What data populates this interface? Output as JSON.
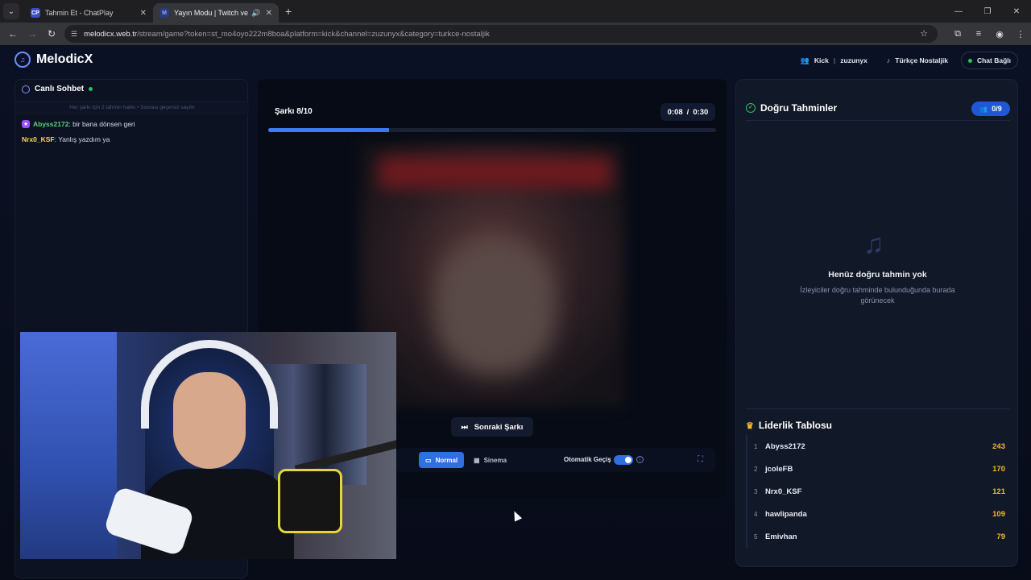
{
  "browser": {
    "tabs": [
      {
        "title": "Tahmin Et - ChatPlay",
        "favicon": "CP"
      },
      {
        "title": "Yayın Modu | Twitch ve Kick",
        "favicon": "M"
      }
    ],
    "url_host": "melodicx.web.tr",
    "url_path": "/stream/game?token=st_mo4oyo222m8boa&platform=kick&channel=zuzunyx&category=turkce-nostaljik"
  },
  "app": {
    "brand": "MelodicX",
    "header": {
      "platform": "Kick",
      "channel": "zuzunyx",
      "category": "Türkçe Nostaljik",
      "chat_status": "Chat Bağlı"
    },
    "chat": {
      "title": "Canlı Sohbet",
      "note": "Her şarkı için 2 tahmin hakkı • Sonrası geçersiz sayılır",
      "messages": [
        {
          "user": "Abyss2172",
          "text": ": bir bana dönsen geri"
        },
        {
          "user": "Nrx0_KSF",
          "text": ": Yanlış yazdım ya"
        }
      ]
    },
    "player": {
      "song_label": "Şarkı 8/10",
      "elapsed": "0:08",
      "time_sep": "/",
      "duration": "0:30",
      "progress": 0.27,
      "next_label": "Sonraki Şarkı",
      "mode_normal": "Normal",
      "mode_sinema": "Sinema",
      "auto_label": "Otomatik Geçiş",
      "auto_on": true
    },
    "correct": {
      "title": "Doğru Tahminler",
      "count": "0/9",
      "empty_title": "Henüz doğru tahmin yok",
      "empty_desc": "İzleyiciler doğru tahminde bulunduğunda burada görünecek"
    },
    "leaderboard": {
      "title": "Liderlik Tablosu",
      "rows": [
        {
          "rank": "1",
          "name": "Abyss2172",
          "score": "243"
        },
        {
          "rank": "2",
          "name": "jcoleFB",
          "score": "170"
        },
        {
          "rank": "3",
          "name": "Nrx0_KSF",
          "score": "121"
        },
        {
          "rank": "4",
          "name": "hawlipanda",
          "score": "109"
        },
        {
          "rank": "5",
          "name": "Emivhan",
          "score": "79"
        }
      ]
    }
  },
  "colors": {
    "accent": "#3b7df5",
    "live": "#22c55e",
    "gold": "#f5b728"
  }
}
